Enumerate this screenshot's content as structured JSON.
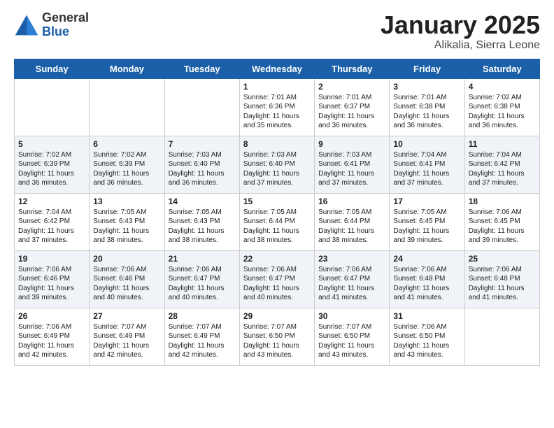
{
  "logo": {
    "general": "General",
    "blue": "Blue"
  },
  "title": {
    "month": "January 2025",
    "location": "Alikalia, Sierra Leone"
  },
  "days_of_week": [
    "Sunday",
    "Monday",
    "Tuesday",
    "Wednesday",
    "Thursday",
    "Friday",
    "Saturday"
  ],
  "weeks": [
    [
      {
        "day": "",
        "info": ""
      },
      {
        "day": "",
        "info": ""
      },
      {
        "day": "",
        "info": ""
      },
      {
        "day": "1",
        "info": "Sunrise: 7:01 AM\nSunset: 6:36 PM\nDaylight: 11 hours\nand 35 minutes."
      },
      {
        "day": "2",
        "info": "Sunrise: 7:01 AM\nSunset: 6:37 PM\nDaylight: 11 hours\nand 36 minutes."
      },
      {
        "day": "3",
        "info": "Sunrise: 7:01 AM\nSunset: 6:38 PM\nDaylight: 11 hours\nand 36 minutes."
      },
      {
        "day": "4",
        "info": "Sunrise: 7:02 AM\nSunset: 6:38 PM\nDaylight: 11 hours\nand 36 minutes."
      }
    ],
    [
      {
        "day": "5",
        "info": "Sunrise: 7:02 AM\nSunset: 6:39 PM\nDaylight: 11 hours\nand 36 minutes."
      },
      {
        "day": "6",
        "info": "Sunrise: 7:02 AM\nSunset: 6:39 PM\nDaylight: 11 hours\nand 36 minutes."
      },
      {
        "day": "7",
        "info": "Sunrise: 7:03 AM\nSunset: 6:40 PM\nDaylight: 11 hours\nand 36 minutes."
      },
      {
        "day": "8",
        "info": "Sunrise: 7:03 AM\nSunset: 6:40 PM\nDaylight: 11 hours\nand 37 minutes."
      },
      {
        "day": "9",
        "info": "Sunrise: 7:03 AM\nSunset: 6:41 PM\nDaylight: 11 hours\nand 37 minutes."
      },
      {
        "day": "10",
        "info": "Sunrise: 7:04 AM\nSunset: 6:41 PM\nDaylight: 11 hours\nand 37 minutes."
      },
      {
        "day": "11",
        "info": "Sunrise: 7:04 AM\nSunset: 6:42 PM\nDaylight: 11 hours\nand 37 minutes."
      }
    ],
    [
      {
        "day": "12",
        "info": "Sunrise: 7:04 AM\nSunset: 6:42 PM\nDaylight: 11 hours\nand 37 minutes."
      },
      {
        "day": "13",
        "info": "Sunrise: 7:05 AM\nSunset: 6:43 PM\nDaylight: 11 hours\nand 38 minutes."
      },
      {
        "day": "14",
        "info": "Sunrise: 7:05 AM\nSunset: 6:43 PM\nDaylight: 11 hours\nand 38 minutes."
      },
      {
        "day": "15",
        "info": "Sunrise: 7:05 AM\nSunset: 6:44 PM\nDaylight: 11 hours\nand 38 minutes."
      },
      {
        "day": "16",
        "info": "Sunrise: 7:05 AM\nSunset: 6:44 PM\nDaylight: 11 hours\nand 38 minutes."
      },
      {
        "day": "17",
        "info": "Sunrise: 7:05 AM\nSunset: 6:45 PM\nDaylight: 11 hours\nand 39 minutes."
      },
      {
        "day": "18",
        "info": "Sunrise: 7:06 AM\nSunset: 6:45 PM\nDaylight: 11 hours\nand 39 minutes."
      }
    ],
    [
      {
        "day": "19",
        "info": "Sunrise: 7:06 AM\nSunset: 6:46 PM\nDaylight: 11 hours\nand 39 minutes."
      },
      {
        "day": "20",
        "info": "Sunrise: 7:06 AM\nSunset: 6:46 PM\nDaylight: 11 hours\nand 40 minutes."
      },
      {
        "day": "21",
        "info": "Sunrise: 7:06 AM\nSunset: 6:47 PM\nDaylight: 11 hours\nand 40 minutes."
      },
      {
        "day": "22",
        "info": "Sunrise: 7:06 AM\nSunset: 6:47 PM\nDaylight: 11 hours\nand 40 minutes."
      },
      {
        "day": "23",
        "info": "Sunrise: 7:06 AM\nSunset: 6:47 PM\nDaylight: 11 hours\nand 41 minutes."
      },
      {
        "day": "24",
        "info": "Sunrise: 7:06 AM\nSunset: 6:48 PM\nDaylight: 11 hours\nand 41 minutes."
      },
      {
        "day": "25",
        "info": "Sunrise: 7:06 AM\nSunset: 6:48 PM\nDaylight: 11 hours\nand 41 minutes."
      }
    ],
    [
      {
        "day": "26",
        "info": "Sunrise: 7:06 AM\nSunset: 6:49 PM\nDaylight: 11 hours\nand 42 minutes."
      },
      {
        "day": "27",
        "info": "Sunrise: 7:07 AM\nSunset: 6:49 PM\nDaylight: 11 hours\nand 42 minutes."
      },
      {
        "day": "28",
        "info": "Sunrise: 7:07 AM\nSunset: 6:49 PM\nDaylight: 11 hours\nand 42 minutes."
      },
      {
        "day": "29",
        "info": "Sunrise: 7:07 AM\nSunset: 6:50 PM\nDaylight: 11 hours\nand 43 minutes."
      },
      {
        "day": "30",
        "info": "Sunrise: 7:07 AM\nSunset: 6:50 PM\nDaylight: 11 hours\nand 43 minutes."
      },
      {
        "day": "31",
        "info": "Sunrise: 7:06 AM\nSunset: 6:50 PM\nDaylight: 11 hours\nand 43 minutes."
      },
      {
        "day": "",
        "info": ""
      }
    ]
  ]
}
